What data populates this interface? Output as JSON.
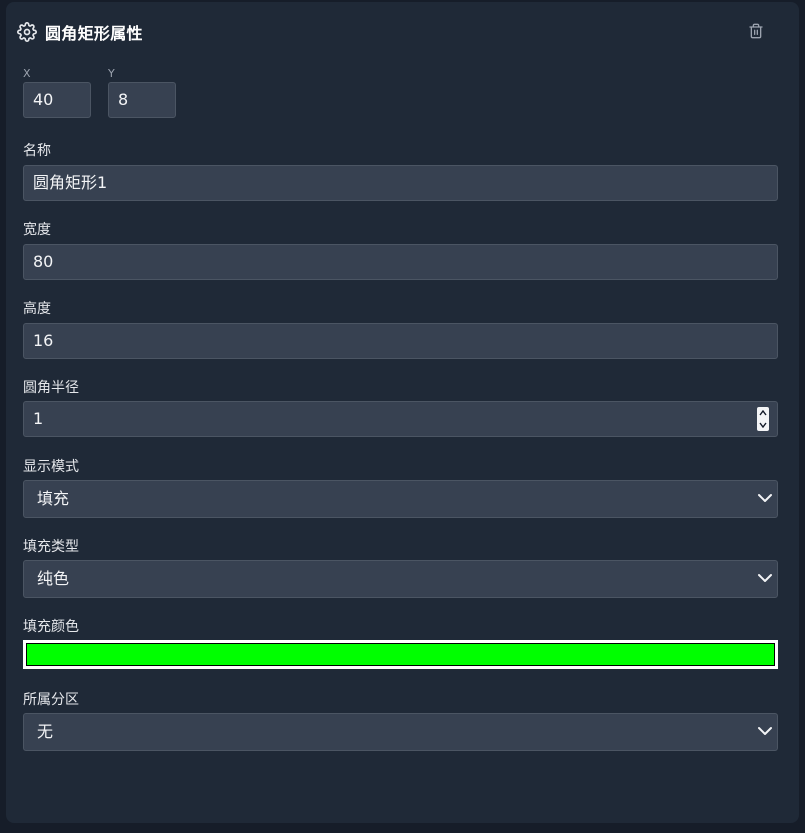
{
  "panel": {
    "title": "圆角矩形属性",
    "icon": "gear-icon",
    "delete_icon": "trash-icon"
  },
  "position": {
    "x_label": "X",
    "x_value": "40",
    "y_label": "Y",
    "y_value": "8"
  },
  "fields": {
    "name": {
      "label": "名称",
      "value": "圆角矩形1"
    },
    "width": {
      "label": "宽度",
      "value": "80"
    },
    "height": {
      "label": "高度",
      "value": "16"
    },
    "radius": {
      "label": "圆角半径",
      "value": "1"
    },
    "display_mode": {
      "label": "显示模式",
      "value": "填充"
    },
    "fill_type": {
      "label": "填充类型",
      "value": "纯色"
    },
    "fill_color": {
      "label": "填充颜色",
      "value": "#00ff00"
    },
    "partition": {
      "label": "所属分区",
      "value": "无"
    }
  },
  "colors": {
    "background": "#161d29",
    "panel": "#1f2937",
    "input": "#374151",
    "fill_color": "#00ff00"
  }
}
